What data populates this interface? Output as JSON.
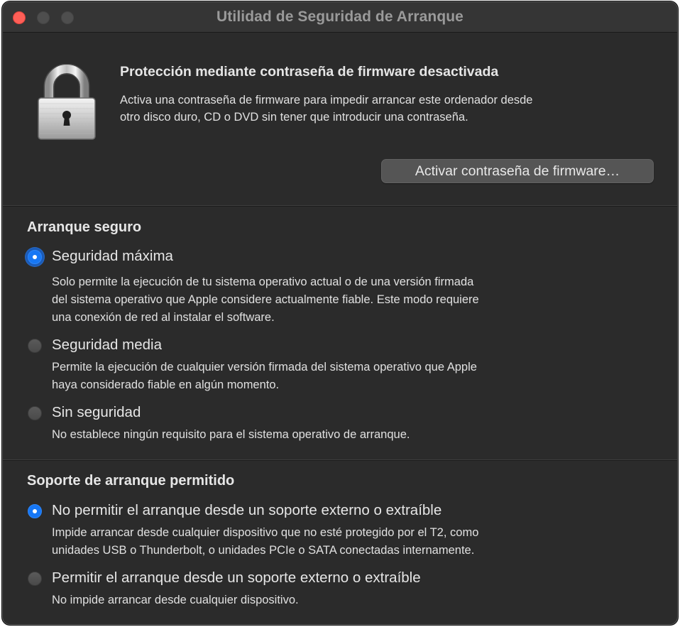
{
  "window": {
    "title": "Utilidad de Seguridad de Arranque"
  },
  "firmware": {
    "heading": "Protección mediante contraseña de firmware desactivada",
    "description_line1": "Activa una contraseña de firmware para impedir arrancar este ordenador desde",
    "description_line2": "otro disco duro, CD o DVD sin tener que introducir una contraseña.",
    "button_label": "Activar contraseña de firmware…",
    "icon": "lock-icon"
  },
  "secure_boot": {
    "title": "Arranque seguro",
    "options": [
      {
        "label": "Seguridad máxima",
        "selected": true,
        "description": [
          "Solo permite la ejecución de tu sistema operativo actual o de una versión firmada",
          "del sistema operativo que Apple considere actualmente fiable. Este modo requiere",
          "una conexión de red al instalar el software."
        ]
      },
      {
        "label": "Seguridad media",
        "selected": false,
        "description": [
          "Permite la ejecución de cualquier versión firmada del sistema operativo que Apple",
          "haya considerado fiable en algún momento."
        ]
      },
      {
        "label": "Sin seguridad",
        "selected": false,
        "description": [
          "No establece ningún requisito para el sistema operativo de arranque."
        ]
      }
    ]
  },
  "boot_media": {
    "title": "Soporte de arranque permitido",
    "options": [
      {
        "label": "No permitir el arranque desde un soporte externo o extraíble",
        "selected": true,
        "description": [
          "Impide arrancar desde cualquier dispositivo que no esté protegido por el T2, como",
          "unidades USB o Thunderbolt, o unidades PCIe o SATA conectadas internamente."
        ]
      },
      {
        "label": "Permitir el arranque desde un soporte externo o extraíble",
        "selected": false,
        "description": [
          "No impide arrancar desde cualquier dispositivo."
        ]
      }
    ]
  },
  "colors": {
    "window_bg": "#2b2b2b",
    "accent": "#1677f5",
    "close_button": "#fe5f57"
  }
}
